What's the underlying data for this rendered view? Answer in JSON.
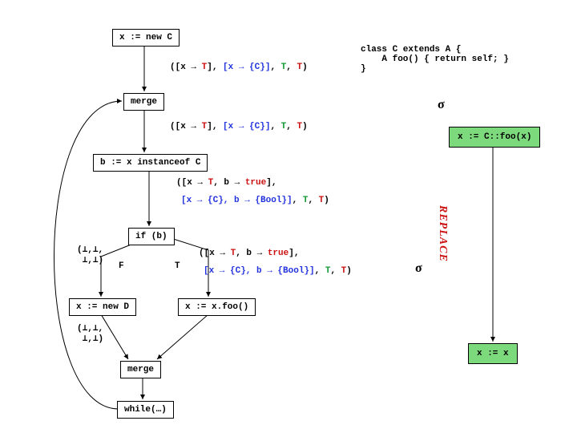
{
  "nodes": {
    "n1": "x := new C",
    "merge1": "merge",
    "binst": "b := x instanceof C",
    "ifb": "if (b)",
    "newD": "x := new D",
    "merge2": "merge",
    "whilen": "while(…)",
    "xfoo": "x := x.foo()",
    "cfoo": "x := C::foo(x)",
    "xassx": "x := x"
  },
  "code": {
    "classC": "class C extends A {\n    A foo() { return self; }\n}"
  },
  "annots": {
    "a1_p1": "([x → ",
    "a1_T": "T",
    "a1_mid": "], ",
    "a1_map": "[x → {C}]",
    "a1_cm": ", ",
    "a1_T2": "T",
    "a1_end": ")",
    "a2_p1": "([x → ",
    "a2_T": "T",
    "a2_mid": "], ",
    "a2_map": "[x → {C}]",
    "a2_cm": ", ",
    "a2_T2": "T",
    "a2_end": ")",
    "a3_l1a": "([x → ",
    "a3_l1T": "T",
    "a3_l1b": ",   b → ",
    "a3_l1true": "true",
    "a3_l1c": "],",
    "a3_l2a": "[x → {C}, b → {Bool}]",
    "a3_l2b": ", ",
    "a3_l2T": "T",
    "a3_l2c": ")",
    "a4_l1a": "([x → ",
    "a4_l1T": "T",
    "a4_l1b": ",   b → ",
    "a4_l1true": "true",
    "a4_l1c": "],",
    "a4_l2a": "[x → {C}, b → {Bool}]",
    "a4_l2b": ", ",
    "a4_l2T": "T",
    "a4_l2c": ")",
    "botA": "(⊥,⊥,\n ⊥,⊥)",
    "botB": "(⊥,⊥,\n ⊥,⊥)",
    "F": "F",
    "T": "T"
  },
  "sigma": "σ",
  "replace": "REPLACE"
}
